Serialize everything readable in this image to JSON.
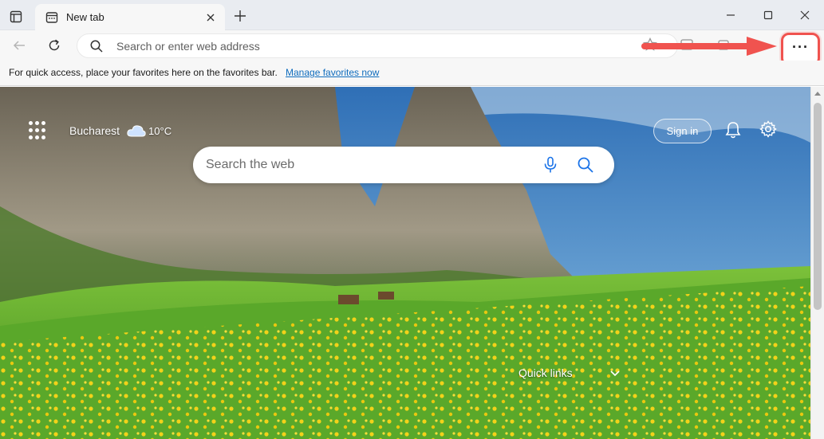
{
  "browser": {
    "tab_title": "New tab",
    "omnibox_placeholder": "Search or enter web address",
    "more_button_label": "···"
  },
  "favorites_bar": {
    "message": "For quick access, place your favorites here on the favorites bar.",
    "manage_link": "Manage favorites now"
  },
  "newtab": {
    "weather_city": "Bucharest",
    "weather_temp": "10°C",
    "sign_in_label": "Sign in",
    "search_placeholder": "Search the web",
    "quick_links_label": "Quick links"
  },
  "colors": {
    "highlight": "#f0534f",
    "link": "#0f6cbd",
    "search_icon_blue": "#1a73e8"
  }
}
